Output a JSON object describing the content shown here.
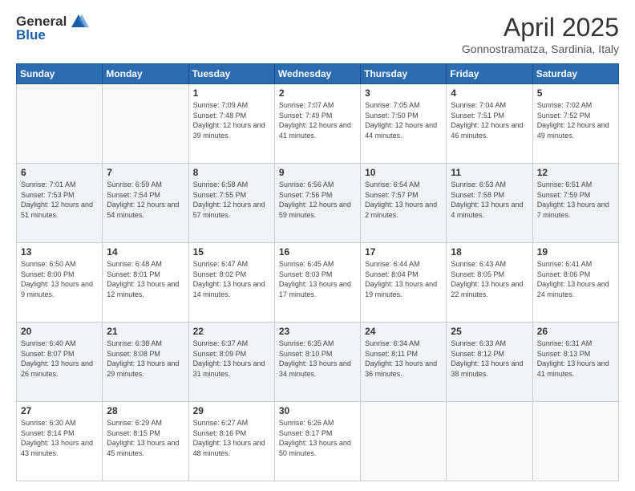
{
  "logo": {
    "line1": "General",
    "line2": "Blue"
  },
  "title": {
    "month": "April 2025",
    "location": "Gonnostramatza, Sardinia, Italy"
  },
  "weekdays": [
    "Sunday",
    "Monday",
    "Tuesday",
    "Wednesday",
    "Thursday",
    "Friday",
    "Saturday"
  ],
  "weeks": [
    [
      {
        "day": "",
        "info": ""
      },
      {
        "day": "",
        "info": ""
      },
      {
        "day": "1",
        "info": "Sunrise: 7:09 AM\nSunset: 7:48 PM\nDaylight: 12 hours and 39 minutes."
      },
      {
        "day": "2",
        "info": "Sunrise: 7:07 AM\nSunset: 7:49 PM\nDaylight: 12 hours and 41 minutes."
      },
      {
        "day": "3",
        "info": "Sunrise: 7:05 AM\nSunset: 7:50 PM\nDaylight: 12 hours and 44 minutes."
      },
      {
        "day": "4",
        "info": "Sunrise: 7:04 AM\nSunset: 7:51 PM\nDaylight: 12 hours and 46 minutes."
      },
      {
        "day": "5",
        "info": "Sunrise: 7:02 AM\nSunset: 7:52 PM\nDaylight: 12 hours and 49 minutes."
      }
    ],
    [
      {
        "day": "6",
        "info": "Sunrise: 7:01 AM\nSunset: 7:53 PM\nDaylight: 12 hours and 51 minutes."
      },
      {
        "day": "7",
        "info": "Sunrise: 6:59 AM\nSunset: 7:54 PM\nDaylight: 12 hours and 54 minutes."
      },
      {
        "day": "8",
        "info": "Sunrise: 6:58 AM\nSunset: 7:55 PM\nDaylight: 12 hours and 57 minutes."
      },
      {
        "day": "9",
        "info": "Sunrise: 6:56 AM\nSunset: 7:56 PM\nDaylight: 12 hours and 59 minutes."
      },
      {
        "day": "10",
        "info": "Sunrise: 6:54 AM\nSunset: 7:57 PM\nDaylight: 13 hours and 2 minutes."
      },
      {
        "day": "11",
        "info": "Sunrise: 6:53 AM\nSunset: 7:58 PM\nDaylight: 13 hours and 4 minutes."
      },
      {
        "day": "12",
        "info": "Sunrise: 6:51 AM\nSunset: 7:59 PM\nDaylight: 13 hours and 7 minutes."
      }
    ],
    [
      {
        "day": "13",
        "info": "Sunrise: 6:50 AM\nSunset: 8:00 PM\nDaylight: 13 hours and 9 minutes."
      },
      {
        "day": "14",
        "info": "Sunrise: 6:48 AM\nSunset: 8:01 PM\nDaylight: 13 hours and 12 minutes."
      },
      {
        "day": "15",
        "info": "Sunrise: 6:47 AM\nSunset: 8:02 PM\nDaylight: 13 hours and 14 minutes."
      },
      {
        "day": "16",
        "info": "Sunrise: 6:45 AM\nSunset: 8:03 PM\nDaylight: 13 hours and 17 minutes."
      },
      {
        "day": "17",
        "info": "Sunrise: 6:44 AM\nSunset: 8:04 PM\nDaylight: 13 hours and 19 minutes."
      },
      {
        "day": "18",
        "info": "Sunrise: 6:43 AM\nSunset: 8:05 PM\nDaylight: 13 hours and 22 minutes."
      },
      {
        "day": "19",
        "info": "Sunrise: 6:41 AM\nSunset: 8:06 PM\nDaylight: 13 hours and 24 minutes."
      }
    ],
    [
      {
        "day": "20",
        "info": "Sunrise: 6:40 AM\nSunset: 8:07 PM\nDaylight: 13 hours and 26 minutes."
      },
      {
        "day": "21",
        "info": "Sunrise: 6:38 AM\nSunset: 8:08 PM\nDaylight: 13 hours and 29 minutes."
      },
      {
        "day": "22",
        "info": "Sunrise: 6:37 AM\nSunset: 8:09 PM\nDaylight: 13 hours and 31 minutes."
      },
      {
        "day": "23",
        "info": "Sunrise: 6:35 AM\nSunset: 8:10 PM\nDaylight: 13 hours and 34 minutes."
      },
      {
        "day": "24",
        "info": "Sunrise: 6:34 AM\nSunset: 8:11 PM\nDaylight: 13 hours and 36 minutes."
      },
      {
        "day": "25",
        "info": "Sunrise: 6:33 AM\nSunset: 8:12 PM\nDaylight: 13 hours and 38 minutes."
      },
      {
        "day": "26",
        "info": "Sunrise: 6:31 AM\nSunset: 8:13 PM\nDaylight: 13 hours and 41 minutes."
      }
    ],
    [
      {
        "day": "27",
        "info": "Sunrise: 6:30 AM\nSunset: 8:14 PM\nDaylight: 13 hours and 43 minutes."
      },
      {
        "day": "28",
        "info": "Sunrise: 6:29 AM\nSunset: 8:15 PM\nDaylight: 13 hours and 45 minutes."
      },
      {
        "day": "29",
        "info": "Sunrise: 6:27 AM\nSunset: 8:16 PM\nDaylight: 13 hours and 48 minutes."
      },
      {
        "day": "30",
        "info": "Sunrise: 6:26 AM\nSunset: 8:17 PM\nDaylight: 13 hours and 50 minutes."
      },
      {
        "day": "",
        "info": ""
      },
      {
        "day": "",
        "info": ""
      },
      {
        "day": "",
        "info": ""
      }
    ]
  ]
}
